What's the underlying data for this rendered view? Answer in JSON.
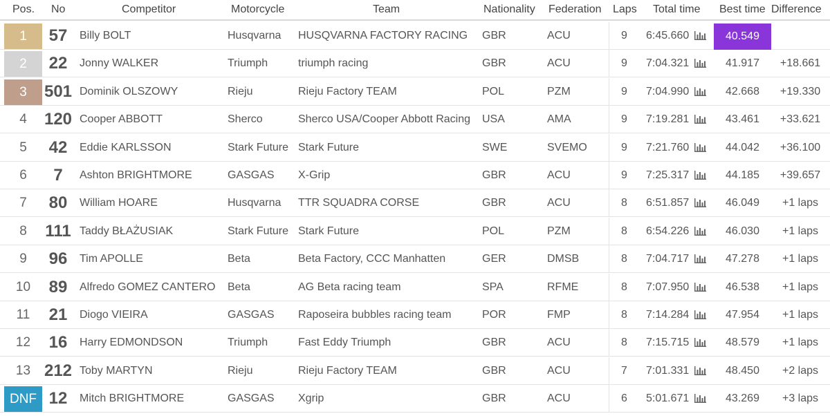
{
  "colors": {
    "gold": "#d6bb8b",
    "silver": "#d4d4d4",
    "bronze": "#bf9f8c",
    "dnf": "#2d9bc6",
    "fastest_lap": "#8a35d9",
    "row_border": "#e3e3e3"
  },
  "header": {
    "pos": "Pos.",
    "no": "No",
    "competitor": "Competitor",
    "motorcycle": "Motorcycle",
    "team": "Team",
    "nationality": "Nationality",
    "federation": "Federation",
    "laps": "Laps",
    "total_time": "Total time",
    "best_time": "Best time",
    "difference": "Difference"
  },
  "icons": {
    "lap_chart": "bar-chart-icon"
  },
  "rows": [
    {
      "pos": "1",
      "medal": "gold",
      "no": "57",
      "competitor": "Billy BOLT",
      "motorcycle": "Husqvarna",
      "team": "HUSQVARNA FACTORY RACING",
      "nationality": "GBR",
      "federation": "ACU",
      "laps": "9",
      "total_time": "6:45.660",
      "best_time": "40.549",
      "fastest": true,
      "difference": ""
    },
    {
      "pos": "2",
      "medal": "silver",
      "no": "22",
      "competitor": "Jonny WALKER",
      "motorcycle": "Triumph",
      "team": "triumph racing",
      "nationality": "GBR",
      "federation": "ACU",
      "laps": "9",
      "total_time": "7:04.321",
      "best_time": "41.917",
      "fastest": false,
      "difference": "+18.661"
    },
    {
      "pos": "3",
      "medal": "bronze",
      "no": "501",
      "competitor": "Dominik OLSZOWY",
      "motorcycle": "Rieju",
      "team": "Rieju Factory TEAM",
      "nationality": "POL",
      "federation": "PZM",
      "laps": "9",
      "total_time": "7:04.990",
      "best_time": "42.668",
      "fastest": false,
      "difference": "+19.330"
    },
    {
      "pos": "4",
      "medal": "",
      "no": "120",
      "competitor": "Cooper ABBOTT",
      "motorcycle": "Sherco",
      "team": "Sherco USA/Cooper Abbott Racing",
      "nationality": "USA",
      "federation": "AMA",
      "laps": "9",
      "total_time": "7:19.281",
      "best_time": "43.461",
      "fastest": false,
      "difference": "+33.621"
    },
    {
      "pos": "5",
      "medal": "",
      "no": "42",
      "competitor": "Eddie KARLSSON",
      "motorcycle": "Stark Future",
      "team": "Stark Future",
      "nationality": "SWE",
      "federation": "SVEMO",
      "laps": "9",
      "total_time": "7:21.760",
      "best_time": "44.042",
      "fastest": false,
      "difference": "+36.100"
    },
    {
      "pos": "6",
      "medal": "",
      "no": "7",
      "competitor": "Ashton BRIGHTMORE",
      "motorcycle": "GASGAS",
      "team": "X-Grip",
      "nationality": "GBR",
      "federation": "ACU",
      "laps": "9",
      "total_time": "7:25.317",
      "best_time": "44.185",
      "fastest": false,
      "difference": "+39.657"
    },
    {
      "pos": "7",
      "medal": "",
      "no": "80",
      "competitor": "William HOARE",
      "motorcycle": "Husqvarna",
      "team": "TTR SQUADRA CORSE",
      "nationality": "GBR",
      "federation": "ACU",
      "laps": "8",
      "total_time": "6:51.857",
      "best_time": "46.049",
      "fastest": false,
      "difference": "+1 laps"
    },
    {
      "pos": "8",
      "medal": "",
      "no": "111",
      "competitor": "Taddy BŁAŻUSIAK",
      "motorcycle": "Stark Future",
      "team": "Stark Future",
      "nationality": "POL",
      "federation": "PZM",
      "laps": "8",
      "total_time": "6:54.226",
      "best_time": "46.030",
      "fastest": false,
      "difference": "+1 laps"
    },
    {
      "pos": "9",
      "medal": "",
      "no": "96",
      "competitor": "Tim APOLLE",
      "motorcycle": "Beta",
      "team": "Beta Factory, CCC Manhatten",
      "nationality": "GER",
      "federation": "DMSB",
      "laps": "8",
      "total_time": "7:04.717",
      "best_time": "47.278",
      "fastest": false,
      "difference": "+1 laps"
    },
    {
      "pos": "10",
      "medal": "",
      "no": "89",
      "competitor": "Alfredo GOMEZ CANTERO",
      "motorcycle": "Beta",
      "team": "AG Beta racing team",
      "nationality": "SPA",
      "federation": "RFME",
      "laps": "8",
      "total_time": "7:07.950",
      "best_time": "46.538",
      "fastest": false,
      "difference": "+1 laps"
    },
    {
      "pos": "11",
      "medal": "",
      "no": "21",
      "competitor": "Diogo VIEIRA",
      "motorcycle": "GASGAS",
      "team": "Raposeira bubbles racing team",
      "nationality": "POR",
      "federation": "FMP",
      "laps": "8",
      "total_time": "7:14.284",
      "best_time": "47.954",
      "fastest": false,
      "difference": "+1 laps"
    },
    {
      "pos": "12",
      "medal": "",
      "no": "16",
      "competitor": "Harry EDMONDSON",
      "motorcycle": "Triumph",
      "team": "Fast Eddy Triumph",
      "nationality": "GBR",
      "federation": "ACU",
      "laps": "8",
      "total_time": "7:15.715",
      "best_time": "48.579",
      "fastest": false,
      "difference": "+1 laps"
    },
    {
      "pos": "13",
      "medal": "",
      "no": "212",
      "competitor": "Toby MARTYN",
      "motorcycle": "Rieju",
      "team": "Rieju Factory TEAM",
      "nationality": "GBR",
      "federation": "ACU",
      "laps": "7",
      "total_time": "7:01.331",
      "best_time": "48.450",
      "fastest": false,
      "difference": "+2 laps"
    },
    {
      "pos": "DNF",
      "medal": "dnf",
      "no": "12",
      "competitor": "Mitch BRIGHTMORE",
      "motorcycle": "GASGAS",
      "team": "Xgrip",
      "nationality": "GBR",
      "federation": "ACU",
      "laps": "6",
      "total_time": "5:01.671",
      "best_time": "43.269",
      "fastest": false,
      "difference": "+3 laps"
    }
  ]
}
